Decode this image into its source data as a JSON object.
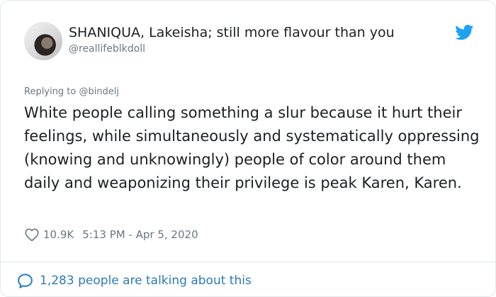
{
  "tweet": {
    "author_name": "SHANIQUA, Lakeisha; still more flavour than you",
    "author_handle": "@reallifeblkdoll",
    "replying_to_prefix": "Replying to",
    "replying_to_handle": "@bindelj",
    "text": "White people calling something a slur because it hurt their feelings, while simultaneously and systematically oppressing (knowing and unknowingly) people of color around them daily and weaponizing their privilege is peak Karen, Karen.",
    "like_count": "10.9K",
    "timestamp": "5:13 PM - Apr 5, 2020",
    "talking_about": "1,283 people are talking about this"
  },
  "icons": {
    "brand": "twitter-bird-icon",
    "like": "heart-icon",
    "conversation": "comment-bubble-icon"
  },
  "colors": {
    "twitter_blue": "#1da1f2",
    "link_blue": "#2b7bb9",
    "muted_text": "#697882",
    "border": "#e1e8ed"
  }
}
